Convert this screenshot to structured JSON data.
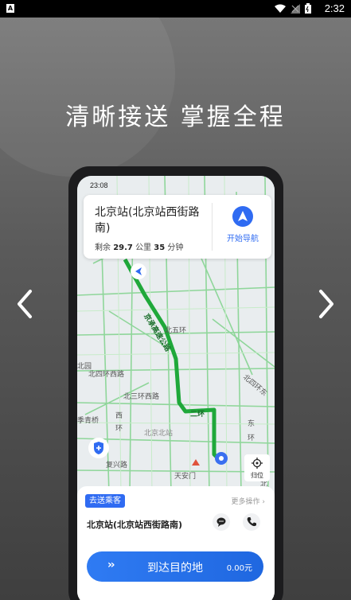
{
  "status_bar": {
    "app_icon": "A",
    "time": "2:32",
    "icons": [
      "wifi-icon",
      "signal-icon",
      "battery-icon"
    ]
  },
  "headline": "清晰接送 掌握全程",
  "phone": {
    "status_time": "23:08",
    "destination": {
      "title": "北京站(北京站西街路南)",
      "remaining_prefix": "剩余",
      "distance": "29.7",
      "distance_unit": "公里",
      "duration": "35",
      "duration_unit": "分钟",
      "navigate_label": "开始导航"
    },
    "map_labels": {
      "expressway": "京承高速公路",
      "ring5": "北五环",
      "yuan": "北园",
      "ring4_west": "北四环西路",
      "ring4_east": "北四环东",
      "ring3_west": "北三环西路",
      "jiqing": "季青桥",
      "west": "西",
      "ring": "环",
      "beijing_north": "北京北站",
      "ring2": "二环",
      "east": "东",
      "ring_e": "环",
      "fuxing": "复兴路",
      "tiananmen": "天安门",
      "return_label": "归位",
      "north": "北"
    },
    "panel": {
      "tag": "去送乘客",
      "more_label": "更多操作",
      "address": "北京站(北京站西街路南)",
      "arrive_label": "到达目的地",
      "fee": "0.00元"
    }
  },
  "colors": {
    "accent": "#2f6bf2",
    "route": "#1fa83a",
    "road": "#6fcf7a"
  }
}
